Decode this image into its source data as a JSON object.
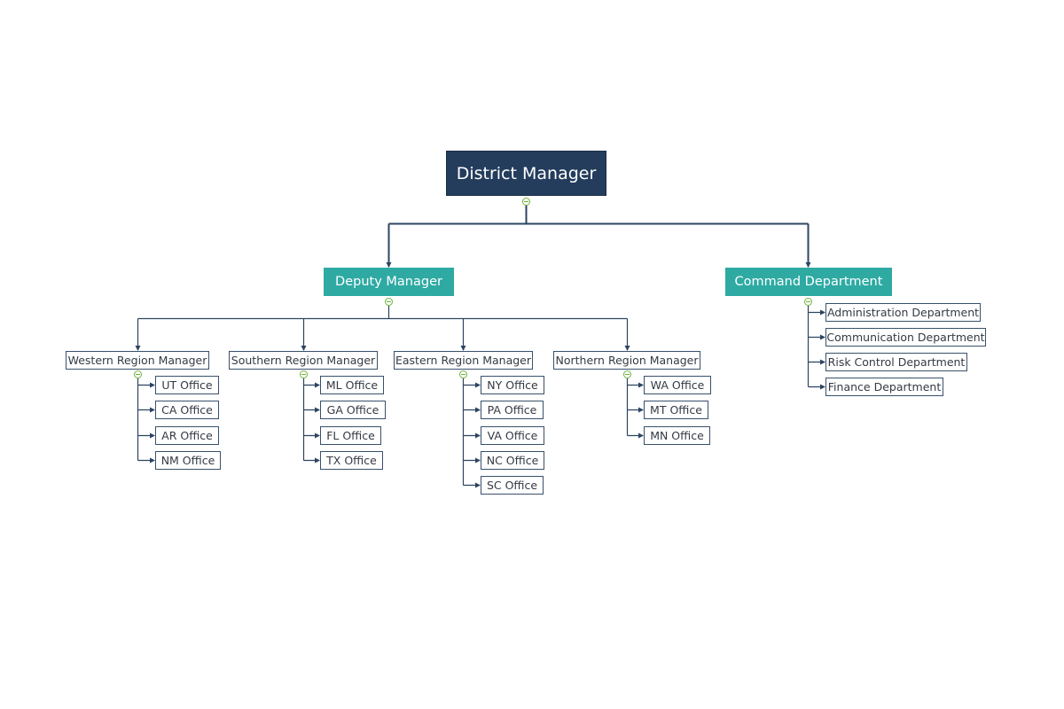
{
  "diagram": {
    "type": "org-chart",
    "colors": {
      "root_fill": "#243d5d",
      "level1_fill": "#2eaaa3",
      "leaf_border": "#38506c",
      "connector": "#2c4460",
      "collapse_toggle": "#6fb33c"
    },
    "root": {
      "label": "District Manager",
      "children": [
        {
          "label": "Deputy Manager",
          "children": [
            {
              "label": "Western Region Manager",
              "children": [
                "UT Office",
                "CA Office",
                "AR Office",
                "NM Office"
              ]
            },
            {
              "label": "Southern Region Manager",
              "children": [
                "ML Office",
                "GA Office",
                "FL Office",
                "TX Office"
              ]
            },
            {
              "label": "Eastern Region Manager",
              "children": [
                "NY Office",
                "PA Office",
                "VA Office",
                "NC Office",
                "SC Office"
              ]
            },
            {
              "label": "Northern Region Manager",
              "children": [
                "WA Office",
                "MT Office",
                "MN Office"
              ]
            }
          ]
        },
        {
          "label": "Command Department",
          "children": [
            "Administration Department",
            "Communication Department",
            "Risk Control Department",
            "Finance Department"
          ]
        }
      ]
    }
  }
}
